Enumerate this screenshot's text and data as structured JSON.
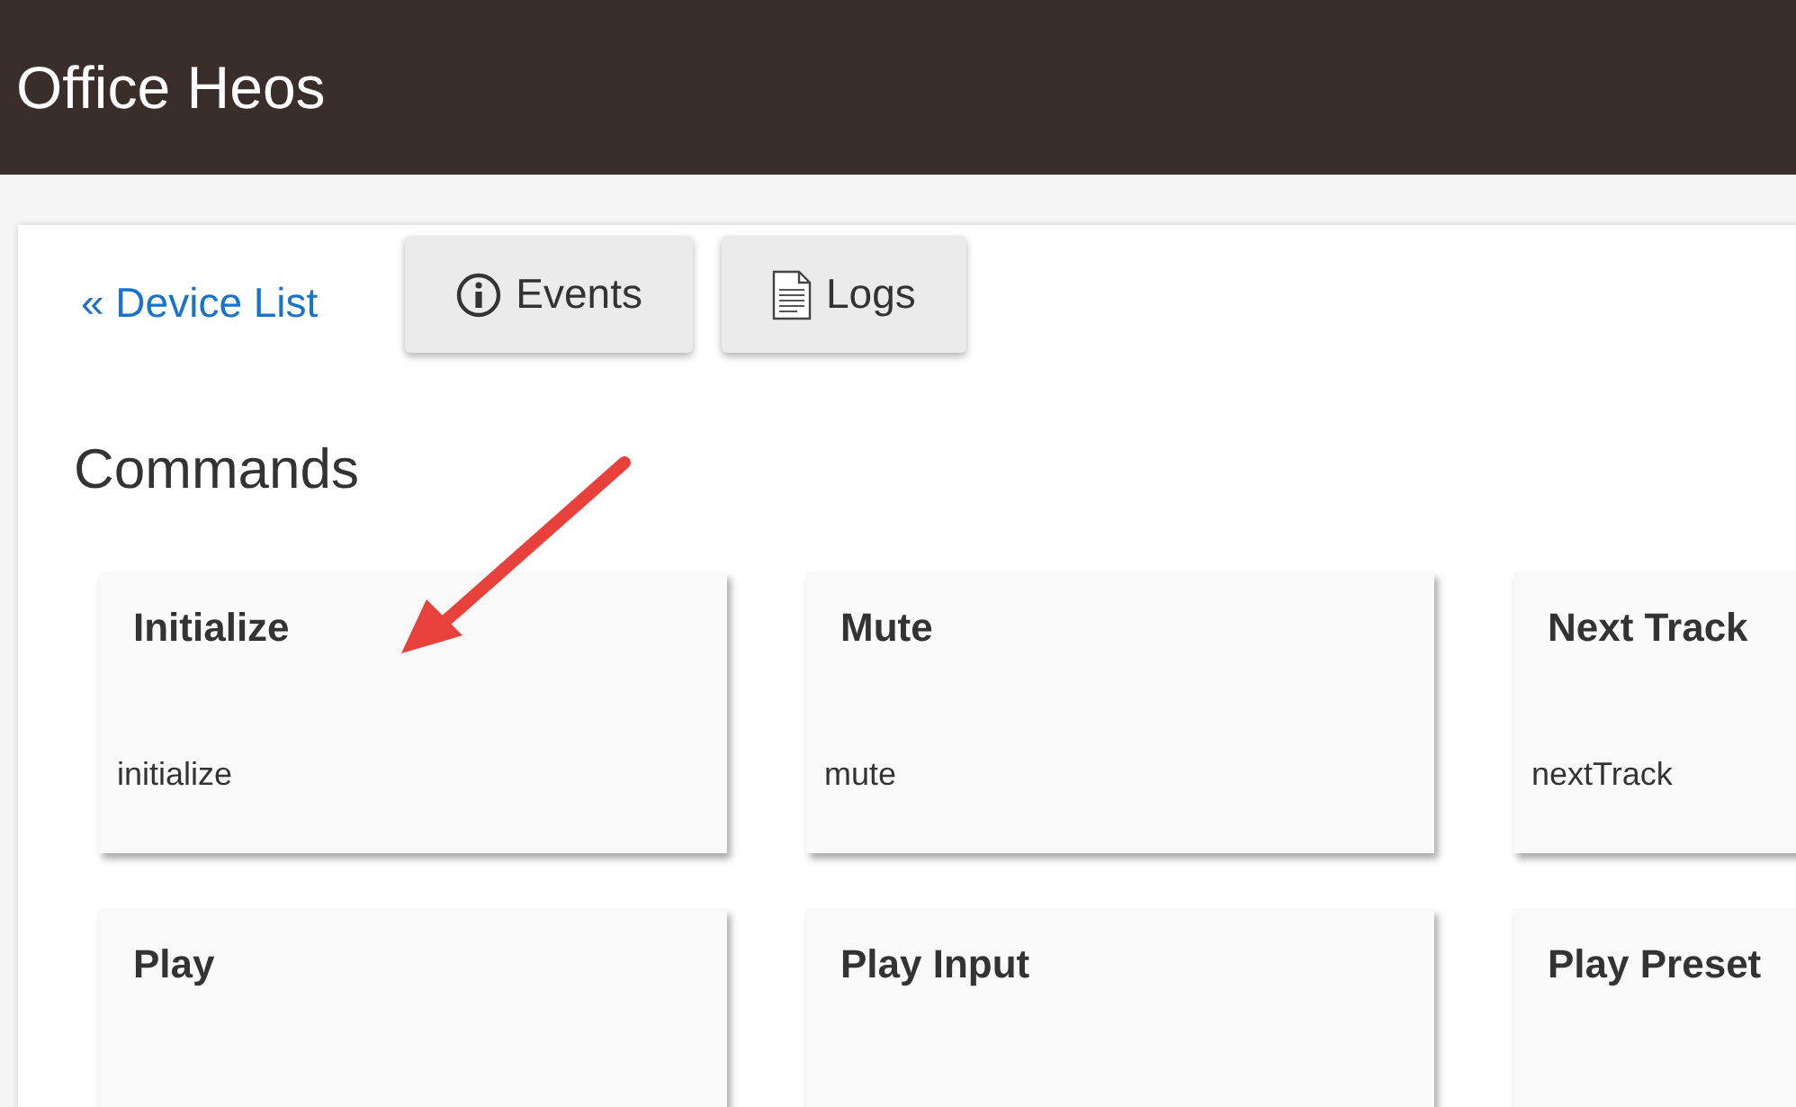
{
  "header": {
    "title": "Office Heos"
  },
  "nav": {
    "back_link": "« Device List",
    "buttons": [
      {
        "kind": "info",
        "label": "Events"
      },
      {
        "kind": "document",
        "label": "Logs"
      }
    ]
  },
  "commands": {
    "heading": "Commands",
    "cards": [
      {
        "title": "Initialize",
        "command": "initialize"
      },
      {
        "title": "Mute",
        "command": "mute"
      },
      {
        "title": "Next Track",
        "command": "nextTrack"
      },
      {
        "title": "Play"
      },
      {
        "title": "Play Input"
      },
      {
        "title": "Play Preset"
      }
    ]
  }
}
